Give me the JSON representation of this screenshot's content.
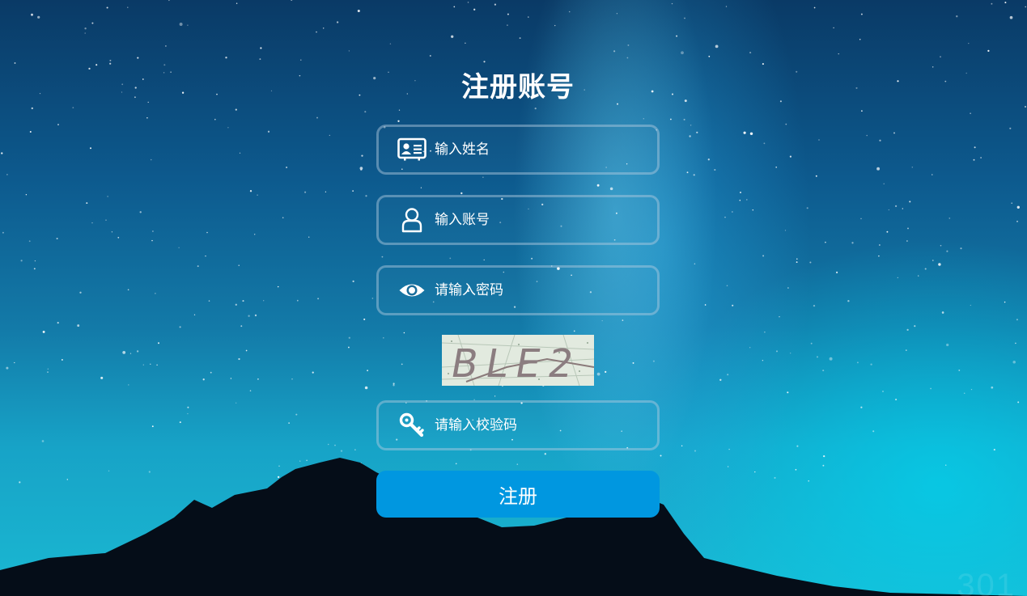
{
  "form": {
    "title": "注册账号",
    "fields": [
      {
        "name": "name",
        "placeholder": "输入姓名",
        "icon": "id-card-icon"
      },
      {
        "name": "account",
        "placeholder": "输入账号",
        "icon": "user-icon"
      },
      {
        "name": "password",
        "placeholder": "请输入密码",
        "icon": "eye-icon"
      },
      {
        "name": "captcha",
        "placeholder": "请输入校验码",
        "icon": "key-icon"
      }
    ],
    "captcha_text": "BLE2",
    "submit_label": "注册"
  },
  "watermark": "301",
  "colors": {
    "button": "#0097e0",
    "field_border": "rgba(180,205,225,0.45)",
    "text": "#ffffff"
  }
}
